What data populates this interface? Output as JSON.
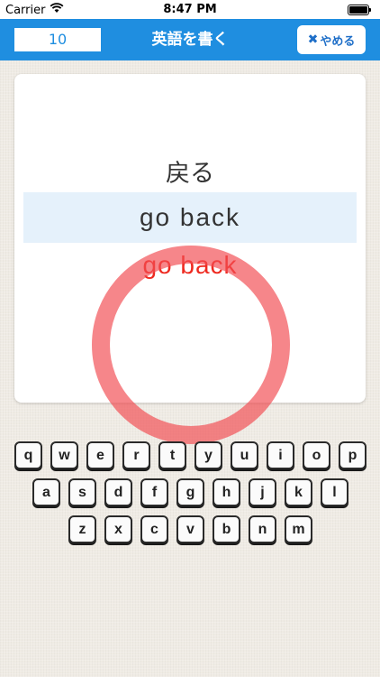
{
  "status_bar": {
    "carrier": "Carrier",
    "time": "8:47 PM"
  },
  "nav": {
    "counter": "10",
    "title": "英語を書く",
    "quit_icon": "close-icon",
    "quit_label": "やめる"
  },
  "card": {
    "prompt": "戻る",
    "answer": "go back",
    "typed": "go back",
    "result": "correct-circle"
  },
  "keyboard": {
    "row1": [
      "q",
      "w",
      "e",
      "r",
      "t",
      "y",
      "u",
      "i",
      "o",
      "p"
    ],
    "row2": [
      "a",
      "s",
      "d",
      "f",
      "g",
      "h",
      "j",
      "k",
      "l"
    ],
    "row3": [
      "z",
      "x",
      "c",
      "v",
      "b",
      "n",
      "m"
    ]
  },
  "colors": {
    "accent": "#1f8ee0",
    "typed_text": "#ee2a20",
    "circle": "#f14c52",
    "answer_highlight": "#e5f1fb"
  }
}
